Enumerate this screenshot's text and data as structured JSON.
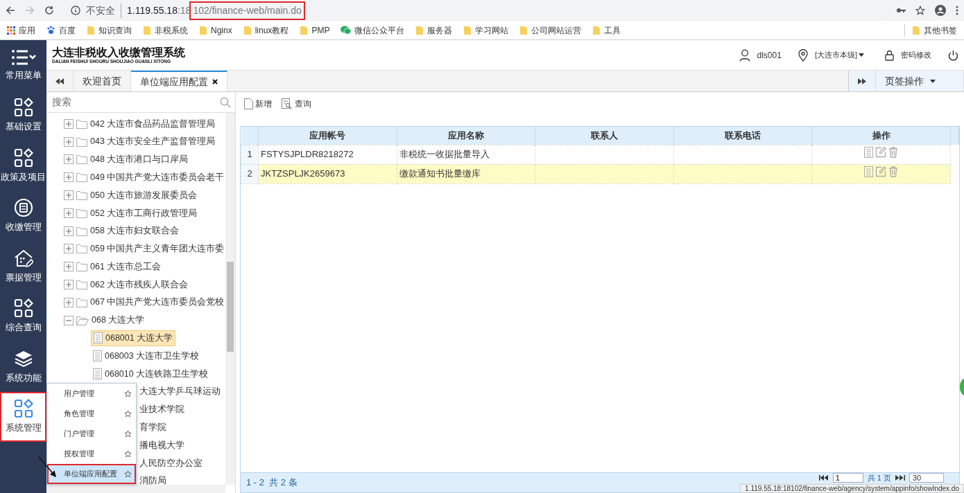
{
  "browser": {
    "security": "不安全",
    "url_host": "1.119.55.18",
    "url_port": ":18",
    "url_path": "102/finance-web/main.do",
    "url_path_highlighted": true,
    "bookmarks": [
      {
        "label": "应用",
        "kind": "apps"
      },
      {
        "label": "百度",
        "kind": "paw"
      },
      {
        "label": "知识查询",
        "kind": "folder"
      },
      {
        "label": "非税系统",
        "kind": "folder"
      },
      {
        "label": "Nginx",
        "kind": "folder"
      },
      {
        "label": "linux教程",
        "kind": "folder"
      },
      {
        "label": "PMP",
        "kind": "folder"
      },
      {
        "label": "微信公众平台",
        "kind": "wechat"
      },
      {
        "label": "服务器",
        "kind": "folder"
      },
      {
        "label": "学习网站",
        "kind": "folder"
      },
      {
        "label": "公司网站运营",
        "kind": "folder"
      },
      {
        "label": "工具",
        "kind": "folder"
      }
    ],
    "other_bookmarks": "其他书签"
  },
  "app": {
    "title": "大连非税收入收缴管理系统",
    "subtitle": "DALIAN FEISHUI SHOURU SHOUJIAO GUANLI XITONG",
    "user": "dls001",
    "region": "[大连市本级]",
    "password": "密码修改"
  },
  "sidebar": [
    {
      "label": "常用菜单",
      "kind": "menu",
      "selected": false,
      "highlighted": false
    },
    {
      "label": "基础设置",
      "kind": "grid",
      "selected": false,
      "highlighted": false
    },
    {
      "label": "政策及项目",
      "kind": "grid",
      "selected": false,
      "highlighted": false
    },
    {
      "label": "收缴管理",
      "kind": "clipboard",
      "selected": false,
      "highlighted": false
    },
    {
      "label": "票据管理",
      "kind": "house",
      "selected": false,
      "highlighted": false
    },
    {
      "label": "综合查询",
      "kind": "grid",
      "selected": false,
      "highlighted": false
    },
    {
      "label": "系统功能",
      "kind": "layers",
      "selected": false,
      "highlighted": false
    },
    {
      "label": "系统管理",
      "kind": "grid",
      "selected": true,
      "highlighted": true
    }
  ],
  "tabs": [
    {
      "label": "欢迎首页",
      "selected": false,
      "closable": false
    },
    {
      "label": "单位端应用配置",
      "selected": true,
      "closable": true
    }
  ],
  "tab_actions": "页签操作",
  "tree": {
    "placeholder": "搜索",
    "items": [
      {
        "label": "042 大连市食品药品监督管理局",
        "expanded": false
      },
      {
        "label": "043 大连市安全生产监督管理局",
        "expanded": false
      },
      {
        "label": "048 大连市港口与口岸局",
        "expanded": false
      },
      {
        "label": "049 中国共产党大连市委员会老干",
        "expanded": false
      },
      {
        "label": "050 大连市旅游发展委员会",
        "expanded": false
      },
      {
        "label": "052 大连市工商行政管理局",
        "expanded": false
      },
      {
        "label": "058 大连市妇女联合会",
        "expanded": false
      },
      {
        "label": "059 中国共产主义青年团大连市委",
        "expanded": false
      },
      {
        "label": "061 大连市总工会",
        "expanded": false
      },
      {
        "label": "062 大连市残疾人联合会",
        "expanded": false
      },
      {
        "label": "067 中国共产党大连市委员会党校",
        "expanded": false
      },
      {
        "label": "068 大连大学",
        "expanded": true,
        "children": [
          {
            "label": "068001 大连大学",
            "selected": true,
            "clipped": false
          },
          {
            "label": "068003 大连市卫生学校",
            "selected": false,
            "clipped": false
          },
          {
            "label": "068010 大连铁路卫生学校",
            "selected": false,
            "clipped": false
          },
          {
            "label": "大连大学乒乓球运动",
            "selected": false,
            "clipped": true
          },
          {
            "label": "业技术学院",
            "selected": false,
            "clipped": true
          },
          {
            "label": "育学院",
            "selected": false,
            "clipped": true
          },
          {
            "label": "播电视大学",
            "selected": false,
            "clipped": true
          },
          {
            "label": "人民防空办公室",
            "selected": false,
            "clipped": true
          },
          {
            "label": "消防局",
            "selected": false,
            "clipped": true
          }
        ]
      }
    ]
  },
  "flyout": [
    {
      "label": "用户管理",
      "selected": false,
      "highlighted": false
    },
    {
      "label": "角色管理",
      "selected": false,
      "highlighted": false
    },
    {
      "label": "门户管理",
      "selected": false,
      "highlighted": false
    },
    {
      "label": "授权管理",
      "selected": false,
      "highlighted": false
    },
    {
      "label": "单位端应用配置",
      "selected": true,
      "highlighted": true
    }
  ],
  "toolbar": [
    {
      "label": "新增",
      "kind": "new"
    },
    {
      "label": "查询",
      "kind": "search"
    }
  ],
  "grid": {
    "columns": [
      "应用帐号",
      "应用名称",
      "联系人",
      "联系电话",
      "操作"
    ],
    "rows": [
      {
        "index": "1",
        "cells": [
          "FSTYSJPLDR8218272",
          "非税统一收据批量导入",
          "",
          ""
        ],
        "selected": false
      },
      {
        "index": "2",
        "cells": [
          "JKTZSPLJK2659673",
          "缴款通知书批量缴库",
          "",
          ""
        ],
        "selected": true
      }
    ]
  },
  "pager": {
    "summary": "1 - 2  共 2 条",
    "page": "1",
    "total": "共 1 页",
    "page_size": "30"
  },
  "status_url": "1.119.55.18:18102/finance-web/agency/system/appinfo/showIndex.do"
}
